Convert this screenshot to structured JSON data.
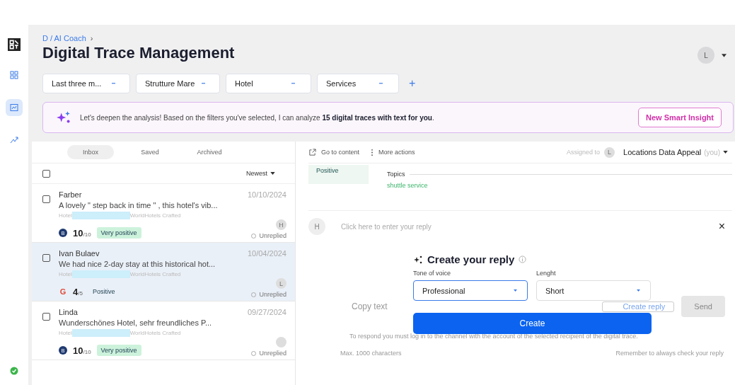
{
  "nav": [
    {
      "selected": false
    },
    {
      "selected": true
    },
    {
      "selected": false
    }
  ],
  "breadcrumb": "D / AI Coach",
  "breadcrumb_sep": "›",
  "title": "Digital Trace Management",
  "user_avatar": "L",
  "filters": [
    {
      "label": "Last three m..."
    },
    {
      "label": "Strutture Mare"
    },
    {
      "label": "Hotel"
    },
    {
      "label": "Services"
    }
  ],
  "add_filter": "+",
  "banner": {
    "text": "Let's deepen the analysis! Based on the filters you've selected, I can analyze **15 digital traces with text for you**.",
    "button": "New Smart Insight"
  },
  "tabs": [
    {
      "label": "Inbox",
      "selected": true
    },
    {
      "label": "Saved",
      "selected": false
    },
    {
      "label": "Archived",
      "selected": false
    }
  ],
  "select_all": {
    "checked": false
  },
  "sort": "Newest",
  "rows": [
    {
      "name": "Farber",
      "excerpt": "A lovely \" step back in time \" , this hotel's vib...",
      "place": "Hotel",
      "brand": "WorldHotels Crafted",
      "date": "10/10/2024",
      "kind": "booking",
      "source_letter": "B",
      "score": "10",
      "scale": "/10",
      "sentiment": "Very positive",
      "tag_filled": true,
      "avatar": "H",
      "status": "Unreplied",
      "checked": false,
      "selected": false
    },
    {
      "name": "Ivan Bulaev",
      "excerpt": "We had nice 2-day stay at this historical hot...",
      "place": "Hotel",
      "brand": "WorldHotels Crafted",
      "date": "10/04/2024",
      "kind": "google",
      "source_letter": "G",
      "score": "4",
      "scale": "/5",
      "sentiment": "Positive",
      "tag_filled": false,
      "avatar": "L",
      "status": "Unreplied",
      "checked": false,
      "selected": true
    },
    {
      "name": "Linda",
      "excerpt": "Wunderschönes Hotel, sehr freundliches P...",
      "place": "Hotel",
      "brand": "WorldHotels Crafted",
      "date": "09/27/2024",
      "kind": "booking",
      "source_letter": "B",
      "score": "10",
      "scale": "/10",
      "sentiment": "Very positive",
      "tag_filled": true,
      "avatar": "",
      "status": "Unreplied",
      "checked": false,
      "selected": false
    }
  ],
  "toolbar": {
    "go": "Go to content",
    "more": "More actions",
    "assigned_label": "Assigned to",
    "assignee_avatar": "L",
    "assignee": "Locations Data Appeal",
    "you": "(you)"
  },
  "detail": {
    "sentiment": "Positive",
    "topics_label": "Topics",
    "topic": "shuttle service"
  },
  "reply": {
    "avatar": "H",
    "placeholder": "Click here to enter your reply",
    "close": "×",
    "copy": "Copy text",
    "create": "Create reply",
    "send": "Send",
    "notice": "To respond you must log in to the channel with the account of the selected recipient of the digital trace.",
    "max": "Max. 1000 characters",
    "remember": "Remember to always check your reply"
  },
  "dialog": {
    "title": "Create your reply",
    "selects": [
      {
        "label": "Tone of voice",
        "value": "Professional",
        "focused": true
      },
      {
        "label": "Lenght",
        "value": "Short",
        "focused": false
      }
    ],
    "button": "Create"
  }
}
